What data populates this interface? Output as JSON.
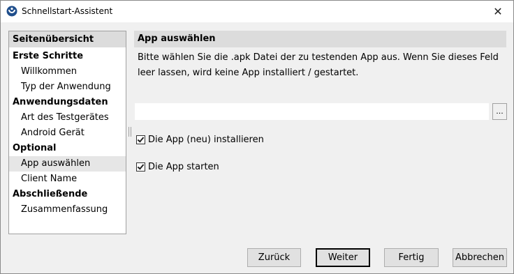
{
  "window": {
    "title": "Schnellstart-Assistent",
    "close_glyph": "✕"
  },
  "sidebar": {
    "header": "Seitenübersicht",
    "groups": [
      {
        "label": "Erste Schritte",
        "items": [
          "Willkommen",
          "Typ der Anwendung"
        ]
      },
      {
        "label": "Anwendungsdaten",
        "items": [
          "Art des Testgerätes",
          "Android Gerät"
        ]
      },
      {
        "label": "Optional",
        "items": [
          "App auswählen",
          "Client Name"
        ]
      },
      {
        "label": "Abschließende",
        "items": [
          "Zusammenfassung"
        ]
      }
    ],
    "selected_item": "App auswählen"
  },
  "main": {
    "title": "App auswählen",
    "description": "Bitte wählen Sie die .apk Datei der zu testenden App aus. Wenn Sie dieses Feld leer lassen, wird keine App installiert / gestartet.",
    "file_path_value": "",
    "browse_label": "...",
    "checkboxes": [
      {
        "label": "Die App (neu) installieren",
        "checked": true
      },
      {
        "label": "Die App starten",
        "checked": true
      }
    ]
  },
  "footer": {
    "back_label": "Zurück",
    "next_label": "Weiter",
    "finish_label": "Fertig",
    "cancel_label": "Abbrechen"
  },
  "colors": {
    "header_bg": "#dcdcdc",
    "selected_bg": "#e6e6e6",
    "icon_blue": "#1f4e8c"
  }
}
